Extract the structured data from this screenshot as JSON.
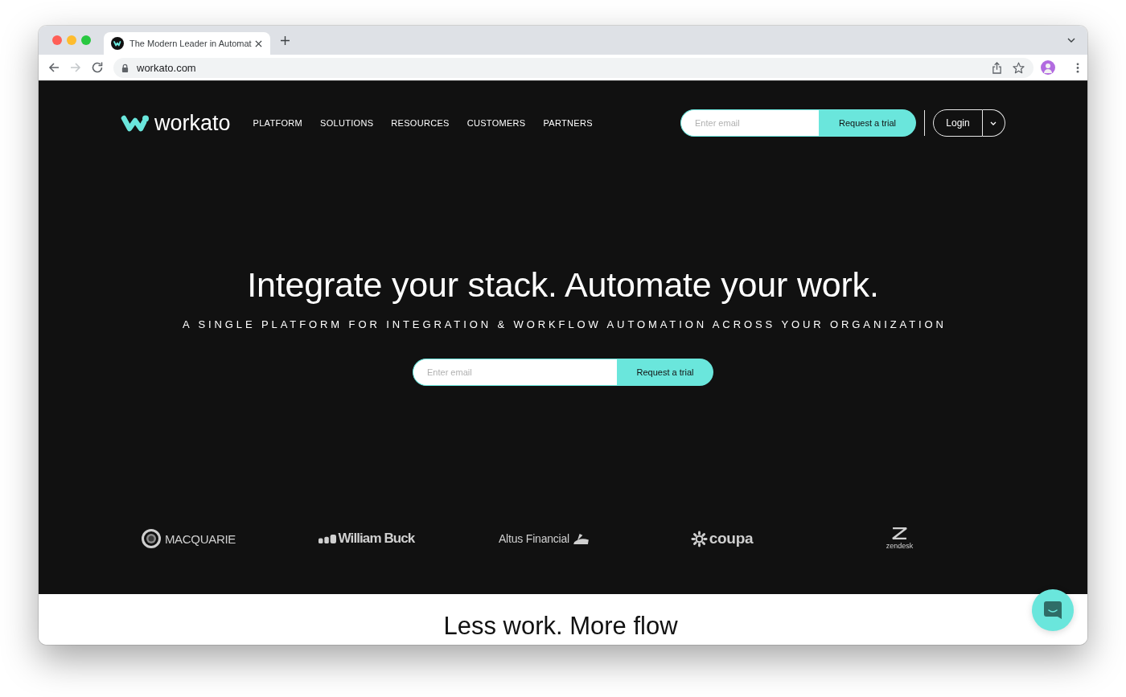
{
  "browser": {
    "tabs": [
      {
        "title": "The Modern Leader in Automat",
        "selected": true
      }
    ],
    "address": "workato.com"
  },
  "header": {
    "logo": "workato",
    "nav": [
      "PLATFORM",
      "SOLUTIONS",
      "RESOURCES",
      "CUSTOMERS",
      "PARTNERS"
    ],
    "email": {
      "placeholder": "Enter email",
      "button": "Request a trial"
    },
    "login": "Login"
  },
  "hero": {
    "title": "Integrate your stack. Automate your work.",
    "subtitle": "A SINGLE PLATFORM FOR INTEGRATION & WORKFLOW AUTOMATION ACROSS YOUR ORGANIZATION",
    "email": {
      "placeholder": "Enter email",
      "button": "Request a trial"
    }
  },
  "customers": [
    {
      "name": "MACQUARIE",
      "kind": "ring"
    },
    {
      "name": "William Buck",
      "kind": "blocks"
    },
    {
      "name": "Altus Financial",
      "kind": "swoosh"
    },
    {
      "name": "coupa",
      "kind": "sunburst"
    },
    {
      "name": "zendesk",
      "kind": "stacked"
    }
  ],
  "next_section": {
    "title": "Less work. More flow"
  }
}
